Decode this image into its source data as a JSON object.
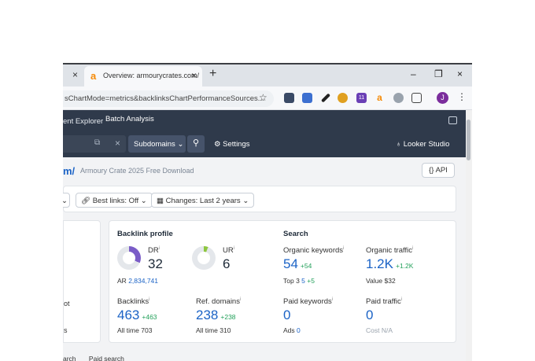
{
  "browser": {
    "prev_tab_close": "×",
    "active_tab": {
      "favicon": "a",
      "title": "Overview: armourycrates.com/",
      "close": "×"
    },
    "new_tab": "+",
    "window_controls": {
      "minimize": "–",
      "restore": "❐",
      "close": "×"
    },
    "url": "sChartMode=metrics&backlinksChartPerformanceSources...",
    "star": "☆",
    "profile_initial": "J",
    "ext_badge": "11",
    "more": "⋮"
  },
  "app": {
    "nav_partial": "ent Explorer",
    "nav_batch": "Batch Analysis",
    "scope": "Subdomains",
    "settings_label": "Settings",
    "looker_label": "Looker Studio",
    "domain_suffix": "m/",
    "domain_subtitle": "Armoury Crate 2025 Free Download",
    "api_label": "API",
    "filters": {
      "best_links": "Best links: Off",
      "changes": "Changes: Last 2 years"
    }
  },
  "left_card": {
    "line1": "ot",
    "line2": "s"
  },
  "backlink_profile": {
    "title": "Backlink profile",
    "dr": {
      "label": "DR",
      "value": "32",
      "fill": 0.32
    },
    "ur": {
      "label": "UR",
      "value": "6",
      "fill": 0.06
    },
    "ar": {
      "label": "AR",
      "value": "2,834,741"
    },
    "backlinks": {
      "label": "Backlinks",
      "value": "463",
      "delta": "+463",
      "alltime_label": "All time",
      "alltime": "703"
    },
    "ref_domains": {
      "label": "Ref. domains",
      "value": "238",
      "delta": "+238",
      "alltime_label": "All time",
      "alltime": "310"
    }
  },
  "search": {
    "title": "Search",
    "organic_keywords": {
      "label": "Organic keywords",
      "value": "54",
      "delta": "+54",
      "top3_label": "Top 3",
      "top3": "5",
      "top3_delta": "+5"
    },
    "organic_traffic": {
      "label": "Organic traffic",
      "value": "1.2K",
      "delta": "+1.2K",
      "value_label": "Value",
      "value_amount": "$32"
    },
    "paid_keywords": {
      "label": "Paid keywords",
      "value": "0",
      "ads_label": "Ads",
      "ads": "0"
    },
    "paid_traffic": {
      "label": "Paid traffic",
      "value": "0",
      "cost_label": "Cost",
      "cost": "N/A"
    }
  },
  "bottom_tabs": {
    "t1": "arch",
    "t2": "Paid search"
  },
  "colors": {
    "header_bg": "#2f3a4b",
    "link_blue": "#1b63c6",
    "positive_green": "#22a05a",
    "dr_donut": "#7a5cc7",
    "ur_donut": "#8dc63f"
  }
}
